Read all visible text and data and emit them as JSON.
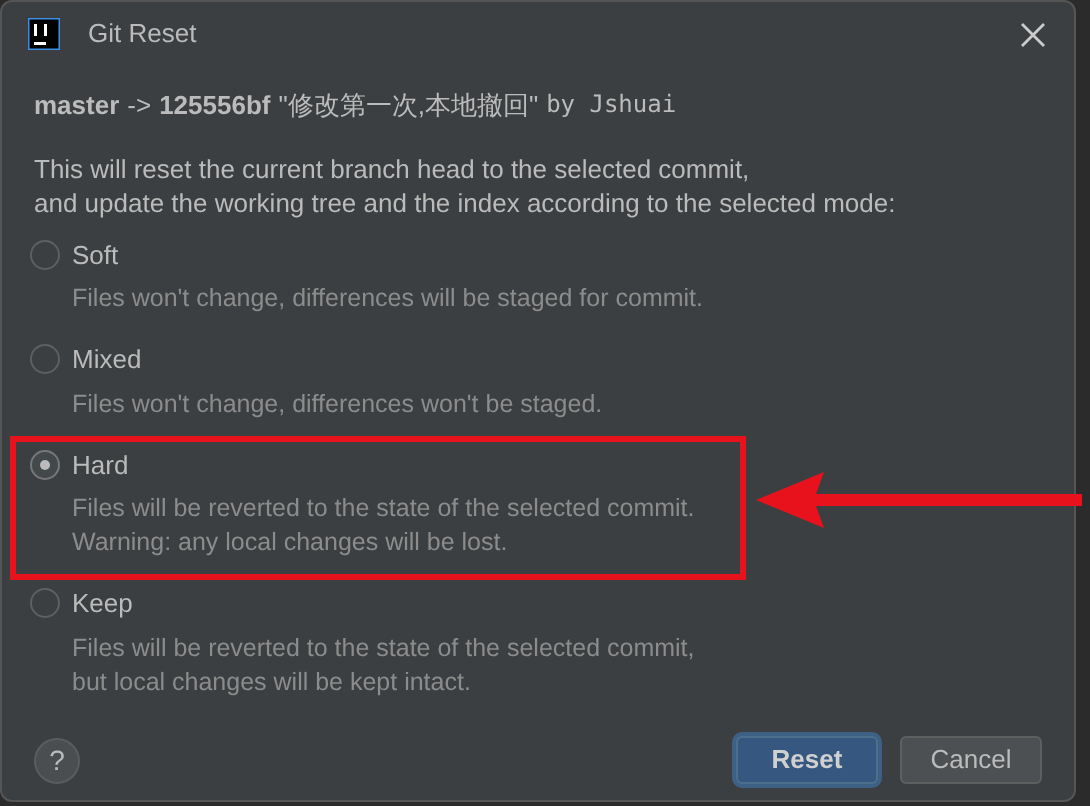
{
  "window": {
    "title": "Git Reset"
  },
  "header": {
    "branch": "master",
    "arrow": "->",
    "commit": "125556bf",
    "message": "\"修改第一次,本地撤回\"",
    "author": "by Jshuai"
  },
  "description": [
    "This will reset the current branch head to the selected commit,",
    "and update the working tree and the index according to the selected mode:"
  ],
  "modes": [
    {
      "label": "Soft",
      "selected": false,
      "lines": [
        "Files won't change, differences will be staged for commit."
      ]
    },
    {
      "label": "Mixed",
      "selected": false,
      "lines": [
        "Files won't change, differences won't be staged."
      ]
    },
    {
      "label": "Hard",
      "selected": true,
      "lines": [
        "Files will be reverted to the state of the selected commit.",
        "Warning: any local changes will be lost."
      ]
    },
    {
      "label": "Keep",
      "selected": false,
      "lines": [
        "Files will be reverted to the state of the selected commit,",
        "but local changes will be kept intact."
      ]
    }
  ],
  "help": "?",
  "buttons": [
    {
      "label": "Reset",
      "kind": "primary"
    },
    {
      "label": "Cancel",
      "kind": "secondary"
    }
  ]
}
